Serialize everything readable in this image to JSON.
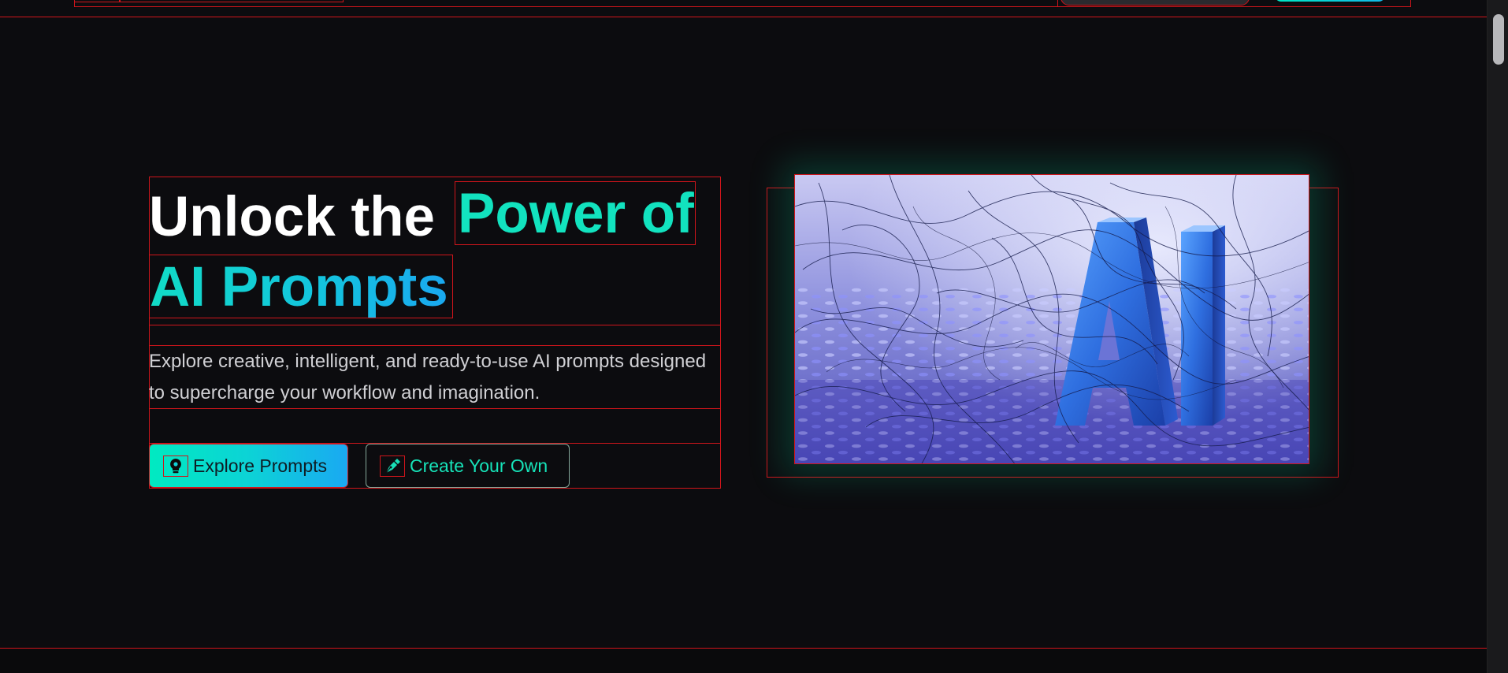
{
  "hero": {
    "headline_part1": "Unlock the ",
    "headline_part2": "Power of",
    "headline_part3": "AI Prompts",
    "subtitle": "Explore creative, intelligent, and ready-to-use AI prompts designed to supercharge your workflow and imagination.",
    "primary_button": {
      "label": "Explore Prompts",
      "icon": "lightbulb-icon"
    },
    "secondary_button": {
      "label": "Create Your Own",
      "icon": "pen-icon"
    },
    "image": {
      "text": "AI"
    }
  },
  "colors": {
    "background": "#0c0c0f",
    "accent_teal": "#12e3bf",
    "accent_blue": "#1aa7f0",
    "debug_outline": "#d0151b"
  }
}
